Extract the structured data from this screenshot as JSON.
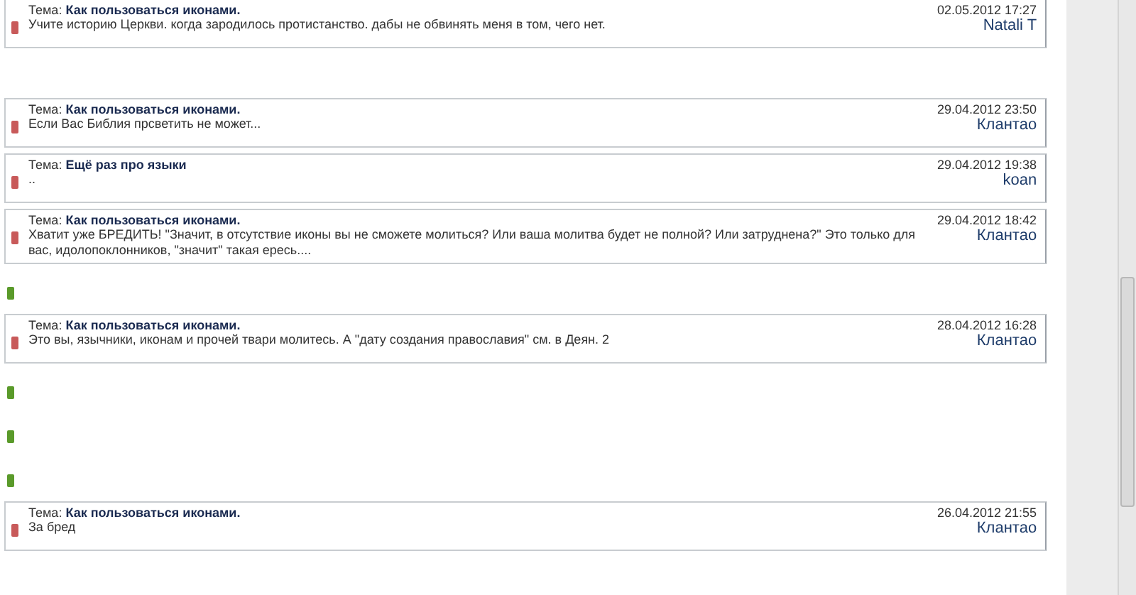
{
  "items": [
    {
      "kind": "post",
      "color": "#c85a5a",
      "topic_label": "Тема:",
      "topic": "Как пользоваться иконами.",
      "date": "02.05.2012 17:27",
      "text": "Учите историю Церкви. когда зародилось протистанство. дабы не обвинять меня в том, чего нет.",
      "author": "Natali T"
    },
    {
      "kind": "gap"
    },
    {
      "kind": "post",
      "color": "#c85a5a",
      "topic_label": "Тема:",
      "topic": "Как пользоваться иконами.",
      "date": "29.04.2012 23:50",
      "text": "Если Вас Библия прсветить не может...",
      "author": "Клантао"
    },
    {
      "kind": "post",
      "color": "#c85a5a",
      "topic_label": "Тема:",
      "topic": "Ещё раз про языки",
      "date": "29.04.2012 19:38",
      "text": "..",
      "author": "koan"
    },
    {
      "kind": "post",
      "color": "#c85a5a",
      "topic_label": "Тема:",
      "topic": "Как пользоваться иконами.",
      "date": "29.04.2012 18:42",
      "text": "Хватит уже БРЕДИТЬ! \"Значит, в отсутствие иконы вы не сможете молиться? Или ваша молитва будет не полной? Или затруднена?\" Это только для вас, идолопоклонников, \"значит\" такая ересь....",
      "author": "Клантао"
    },
    {
      "kind": "gap",
      "color": "#5a9a2a"
    },
    {
      "kind": "post",
      "color": "#c85a5a",
      "topic_label": "Тема:",
      "topic": "Как пользоваться иконами.",
      "date": "28.04.2012 16:28",
      "text": "Это вы, язычники, иконам и прочей твари молитесь. А \"дату создания православия\" см. в Деян. 2",
      "author": "Клантао"
    },
    {
      "kind": "gap",
      "color": "#5a9a2a"
    },
    {
      "kind": "gap",
      "color": "#5a9a2a"
    },
    {
      "kind": "gap",
      "color": "#5a9a2a"
    },
    {
      "kind": "post",
      "color": "#c85a5a",
      "topic_label": "Тема:",
      "topic": "Как пользоваться иконами.",
      "date": "26.04.2012 21:55",
      "text": "За бред",
      "author": "Клантао"
    }
  ]
}
